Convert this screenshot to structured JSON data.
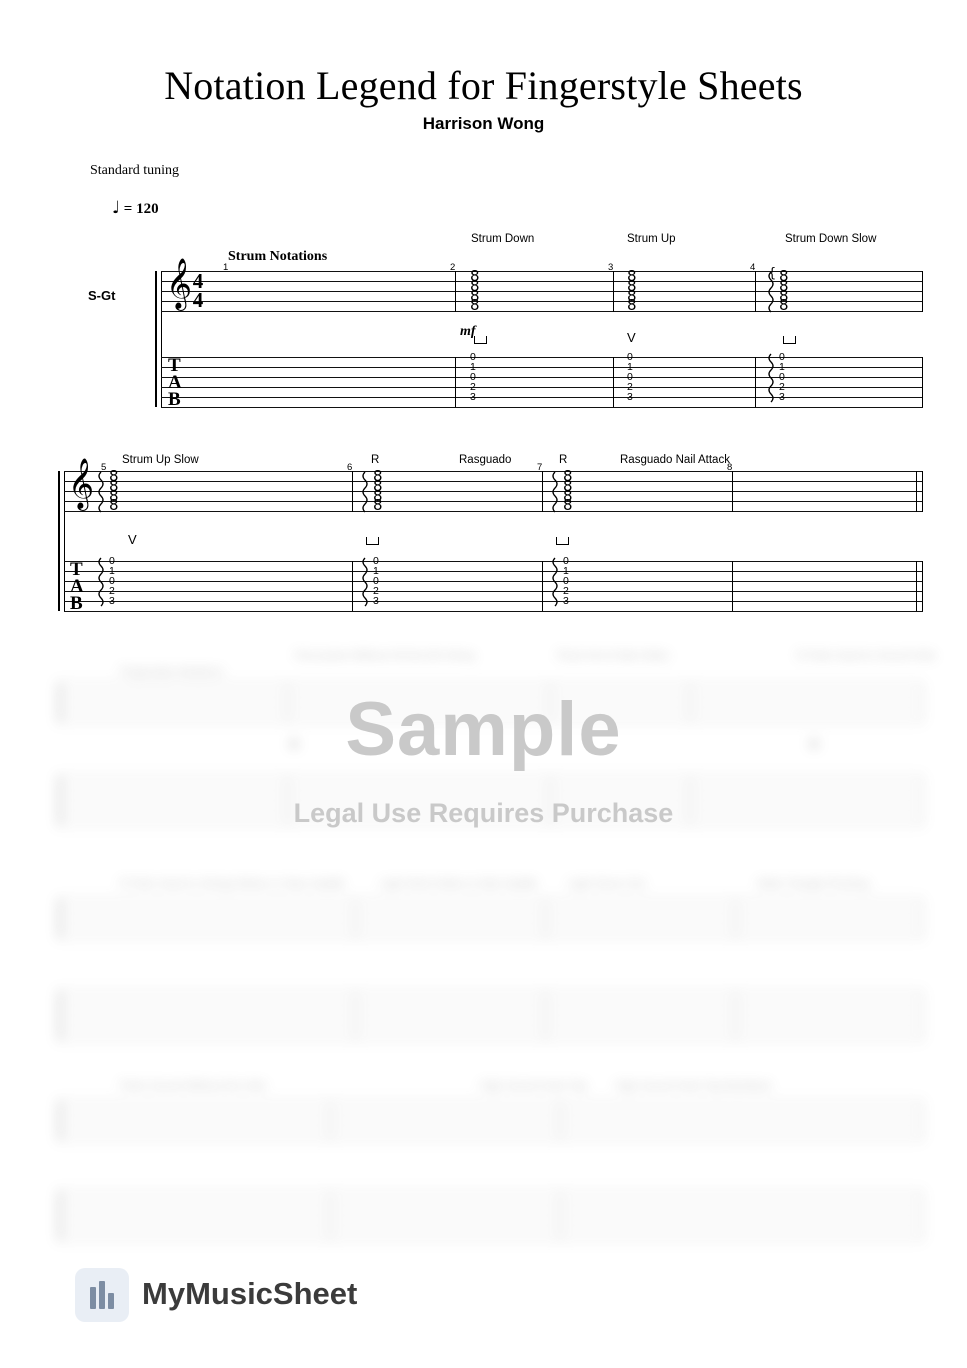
{
  "document": {
    "title": "Notation Legend for Fingerstyle Sheets",
    "composer": "Harrison Wong",
    "tuning": "Standard tuning",
    "tempo_note": "♩",
    "tempo_text": "= 120",
    "instrument_label": "S-Gt",
    "time_signature": {
      "top": "4",
      "bottom": "4"
    },
    "tab_letters": [
      "T",
      "A",
      "B"
    ],
    "clef_symbol": "𝄞"
  },
  "systems": [
    {
      "id": "system-1",
      "section_label": "Strum Notations",
      "measures": [
        {
          "number": "1",
          "label": "",
          "articulation": "",
          "tab": []
        },
        {
          "number": "2",
          "label": "Strum Down",
          "articulation": "down-bow",
          "dynamic": "mf",
          "tab": [
            "0",
            "1",
            "0",
            "2",
            "3"
          ]
        },
        {
          "number": "3",
          "label": "Strum Up",
          "articulation": "up-bow",
          "tab": [
            "0",
            "1",
            "0",
            "2",
            "3"
          ]
        },
        {
          "number": "4",
          "label": "Strum Down Slow",
          "articulation": "down-bow",
          "tab": [
            "0",
            "1",
            "0",
            "2",
            "3"
          ]
        }
      ]
    },
    {
      "id": "system-2",
      "section_label": "",
      "measures": [
        {
          "number": "5",
          "label": "Strum Up Slow",
          "articulation": "up-bow",
          "tab": [
            "0",
            "1",
            "0",
            "2",
            "3"
          ]
        },
        {
          "number": "6",
          "label": "Rasguado",
          "label_small": "R",
          "articulation": "down-bow",
          "tab": [
            "0",
            "1",
            "0",
            "2",
            "3"
          ]
        },
        {
          "number": "7",
          "label": "Rasguado Nail Attack",
          "label_small": "R",
          "articulation": "down-bow",
          "tab": [
            "0",
            "1",
            "0",
            "2",
            "3"
          ]
        },
        {
          "number": "8",
          "label": "",
          "articulation": "",
          "tab": []
        }
      ]
    }
  ],
  "blurred_preview": {
    "labels": [
      "Fingerstyle Notations",
      "Percussive Without Hit the 6th String",
      "Pluck Hit of Side Strike",
      "R   Palm Hand to Sound Hole",
      "R    Palm Hand to Strings Below or Near Saddle",
      "Light Wrist Strike to Side Saddle",
      "Light Strum Out",
      "Wide Triangle Plucking",
      "Flesh Sound Without the Hole",
      "High Sound Hook Tap",
      "High Sound Hook Tap Backbeat"
    ]
  },
  "watermark": {
    "line1": "Sample",
    "line2": "Legal Use Requires Purchase"
  },
  "footer": {
    "brand": "MyMusicSheet",
    "logo_icon": "sheet-music-logo-icon"
  }
}
